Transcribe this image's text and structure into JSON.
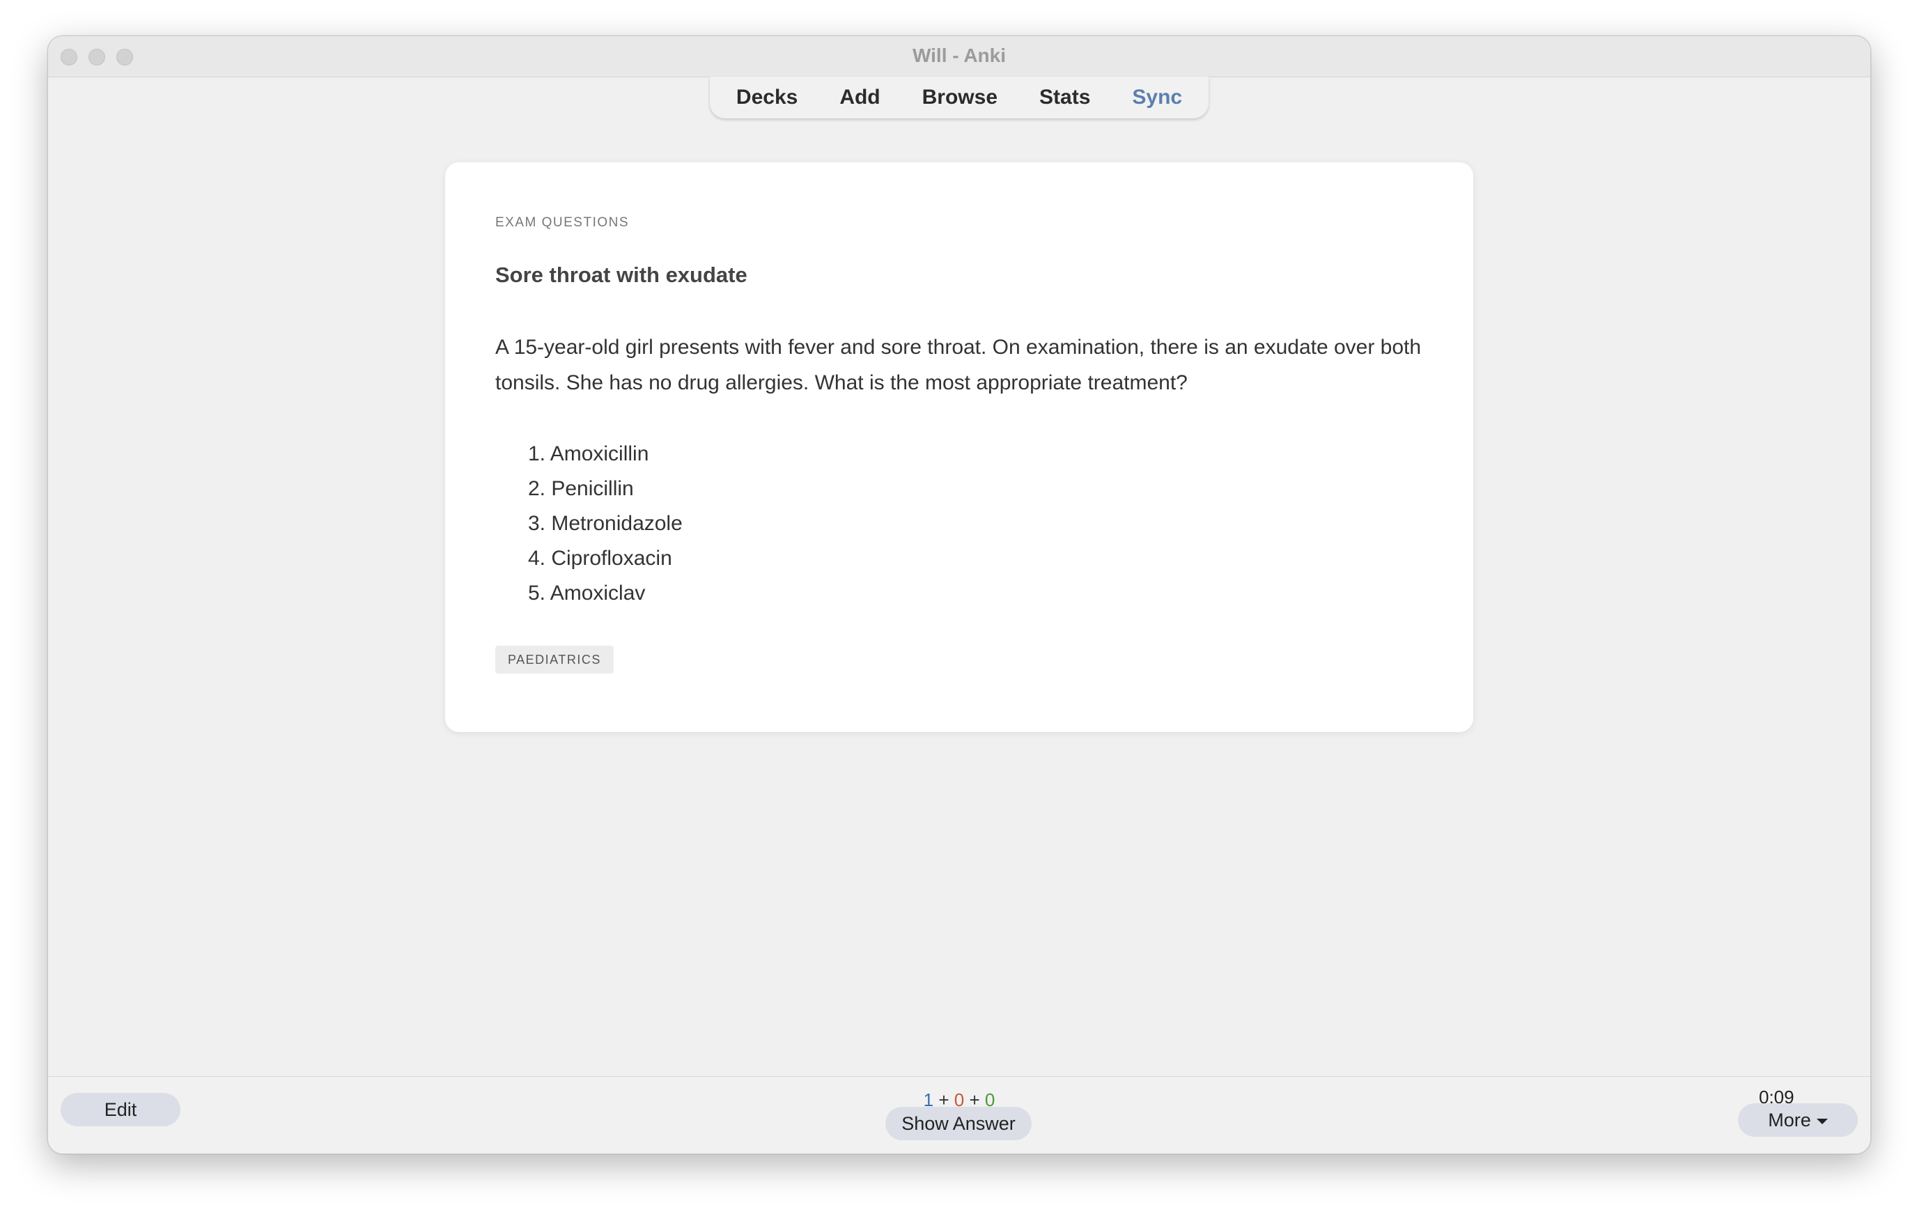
{
  "window": {
    "title": "Will - Anki"
  },
  "toolbar": {
    "items": [
      {
        "label": "Decks"
      },
      {
        "label": "Add"
      },
      {
        "label": "Browse"
      },
      {
        "label": "Stats"
      },
      {
        "label": "Sync"
      }
    ],
    "sync_color": "#5b7fad"
  },
  "card": {
    "deck_label": "EXAM QUESTIONS",
    "title": "Sore throat with exudate",
    "question": "A 15-year-old girl presents with fever and sore throat. On examination, there is an exudate over both tonsils. She has no drug allergies. What is the most appropriate treatment?",
    "options": [
      {
        "num": "1.",
        "text": "Amoxicillin"
      },
      {
        "num": "2.",
        "text": "Penicillin"
      },
      {
        "num": "3.",
        "text": "Metronidazole"
      },
      {
        "num": "4.",
        "text": "Ciprofloxacin"
      },
      {
        "num": "5.",
        "text": "Amoxiclav"
      }
    ],
    "tag": "PAEDIATRICS"
  },
  "bottom_bar": {
    "edit_label": "Edit",
    "show_answer_label": "Show Answer",
    "more_label": "More",
    "timer": "0:09",
    "counts": {
      "new": "1",
      "learning": "0",
      "review": "0",
      "separator": "+"
    },
    "count_colors": {
      "new": "#3a6fb0",
      "learning": "#c35a3a",
      "review": "#4c9a3a"
    }
  }
}
